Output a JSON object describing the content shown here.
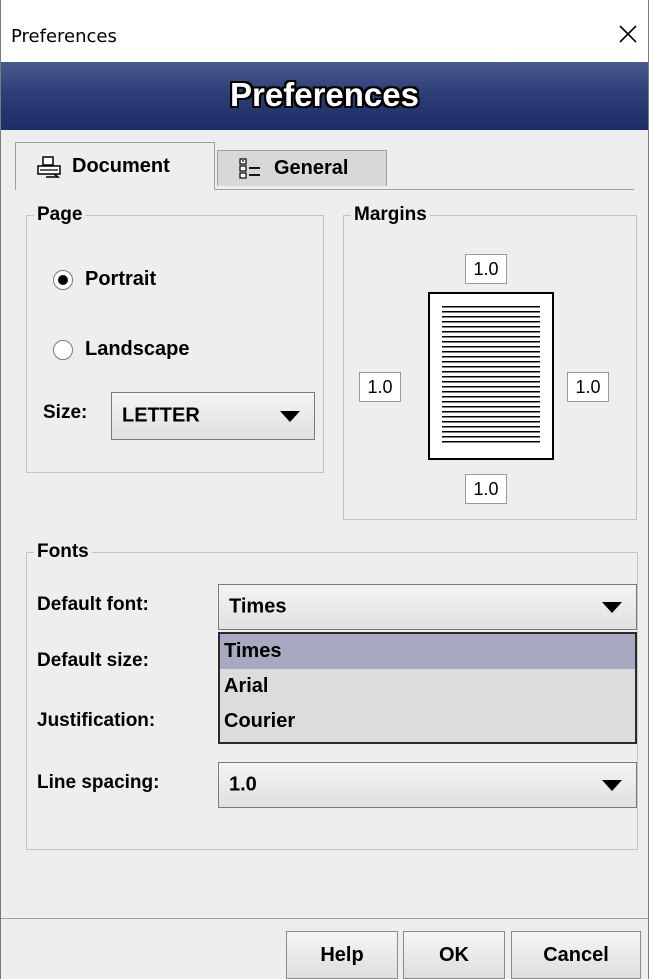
{
  "window": {
    "title": "Preferences"
  },
  "banner": {
    "title": "Preferences"
  },
  "tabs": [
    {
      "label": "Document",
      "icon": "printer-icon",
      "active": true
    },
    {
      "label": "General",
      "icon": "list-icon",
      "active": false
    }
  ],
  "page_group": {
    "legend": "Page",
    "portrait_label": "Portrait",
    "landscape_label": "Landscape",
    "orientation": "Portrait",
    "size_label": "Size:",
    "size_value": "LETTER"
  },
  "margins_group": {
    "legend": "Margins",
    "top": "1.0",
    "left": "1.0",
    "right": "1.0",
    "bottom": "1.0"
  },
  "fonts_group": {
    "legend": "Fonts",
    "default_font_label": "Default font:",
    "default_font_value": "Times",
    "default_size_label": "Default size:",
    "justification_label": "Justification:",
    "line_spacing_label": "Line spacing:",
    "line_spacing_value": "1.0",
    "font_options": [
      "Times",
      "Arial",
      "Courier"
    ],
    "highlighted_option": "Times"
  },
  "buttons": {
    "help": "Help",
    "ok": "OK",
    "cancel": "Cancel"
  },
  "colors": {
    "banner": "#2d3f78",
    "selection": "#a8a8c0",
    "background": "#eeeeee"
  }
}
